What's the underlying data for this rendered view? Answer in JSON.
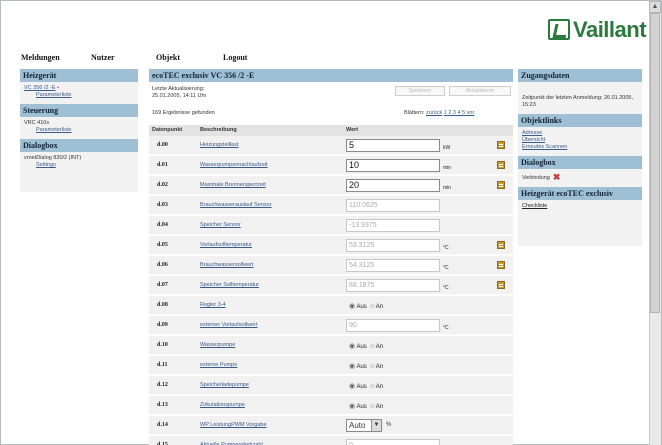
{
  "brand": {
    "name": "Vaillant",
    "color": "#2b7a3d"
  },
  "topnav": [
    "Meldungen",
    "Nutzer",
    "Objekt",
    "Logout"
  ],
  "left": {
    "heizgeraet": {
      "title": "Heizgerät",
      "link": "VC 356 /2 -E",
      "sub": "Parameterliste"
    },
    "steuerung": {
      "title": "Steuerung",
      "device": "VRC 410s",
      "sub": "Parameterliste"
    },
    "dialogbox": {
      "title": "Dialogbox",
      "device": "vrnetDialog 830/2 (INT)",
      "sub": "Settings"
    }
  },
  "center": {
    "title": "ecoTEC exclusiv VC 356 /2 -E",
    "update_label": "Letzte Aktualisierung:",
    "update_time": "25.01.2005, 14:11 Uhr",
    "btn_save": "Speichern",
    "btn_refresh": "Aktualisieren",
    "result_count": "169 Ergebnisse gefunden",
    "pager_label": "Blättern:",
    "pager_back": "zurück",
    "pager_pages": "1 2 3 4 5 vor",
    "col_code": "Datenpunkt",
    "col_desc": "Beschreibung",
    "col_value": "Wert",
    "rows": [
      {
        "code": "d.00",
        "desc": "Heizungsteillast",
        "value": "5",
        "unit": "kW",
        "doc": true
      },
      {
        "code": "d.01",
        "desc": "Wasserpumpennachlaufzeit",
        "value": "10",
        "unit": "min",
        "doc": true
      },
      {
        "code": "d.02",
        "desc": "Maximale Brennersperrzeit",
        "value": "20",
        "unit": "min",
        "doc": true
      },
      {
        "code": "d.03",
        "desc": "Brauchwasserauslauf Sensor",
        "value": "110.0625",
        "unit": "",
        "disabled": true
      },
      {
        "code": "d.04",
        "desc": "Speicher Sensor",
        "value": "-13.9375",
        "unit": "",
        "disabled": true
      },
      {
        "code": "d.05",
        "desc": "Vorlaufsolltemperatur",
        "value": "53.3125",
        "unit": "°C",
        "disabled": true,
        "doc": true
      },
      {
        "code": "d.06",
        "desc": "Brauchwassersollwert",
        "value": "54.3125",
        "unit": "°C",
        "disabled": true,
        "doc": true
      },
      {
        "code": "d.07",
        "desc": "Speicher Solltemperatur",
        "value": "88.1875",
        "unit": "°C",
        "disabled": true,
        "doc": true
      },
      {
        "code": "d.08",
        "desc": "Regler 3-4",
        "radio": true
      },
      {
        "code": "d.09",
        "desc": "externer Vorlaufsollwert",
        "value": "90",
        "unit": "°C",
        "disabled": true
      },
      {
        "code": "d.10",
        "desc": "Wasserpumpe",
        "radio": true
      },
      {
        "code": "d.11",
        "desc": "externe Pumpe",
        "radio": true
      },
      {
        "code": "d.12",
        "desc": "Speicherladepumpe",
        "radio": true
      },
      {
        "code": "d.13",
        "desc": "Zirkulationspumpe",
        "radio": true
      },
      {
        "code": "d.14",
        "desc": "WP LeistungPWM Vorgabe",
        "select": "Auto",
        "unit": "%"
      },
      {
        "code": "d.15",
        "desc": "Aktuelle Pumpendrehzahl",
        "value": "0",
        "unit": "%",
        "disabled": true
      }
    ],
    "radio_off": "Aus",
    "radio_on": "An"
  },
  "right": {
    "zugang": {
      "title": "Zugangsdaten",
      "text": "Zeitpunkt der letzten Anmeldung: 26.01.2005, 15:23"
    },
    "objektlinks": {
      "title": "Objektlinks",
      "links": [
        "Adresse",
        "Übersicht",
        "Erneutes Scannen"
      ]
    },
    "dialogbox": {
      "title": "Dialogbox",
      "label": "Verbindung"
    },
    "heizgeraet": {
      "title": "Heizgerät ecoTEC exclusiv",
      "link": "Checkliste"
    }
  }
}
